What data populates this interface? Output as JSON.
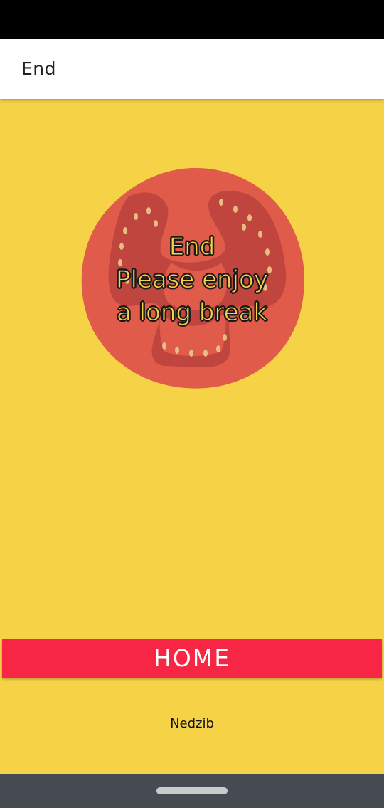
{
  "app_bar": {
    "title": "End"
  },
  "main": {
    "image_icon": "tomato-slice-icon",
    "message_lines": [
      "End",
      "Please enjoy",
      "a long break"
    ],
    "home_button_label": "HOME",
    "author": "Nedzib"
  },
  "colors": {
    "background": "#F5D246",
    "app_bar": "#FFFFFF",
    "home_button": "#F72644",
    "tomato": "#E15B4B",
    "tomato_inner": "#B33E39",
    "seed": "#E8BE80",
    "nav_bar": "#464B51",
    "status_bar": "#000000"
  }
}
